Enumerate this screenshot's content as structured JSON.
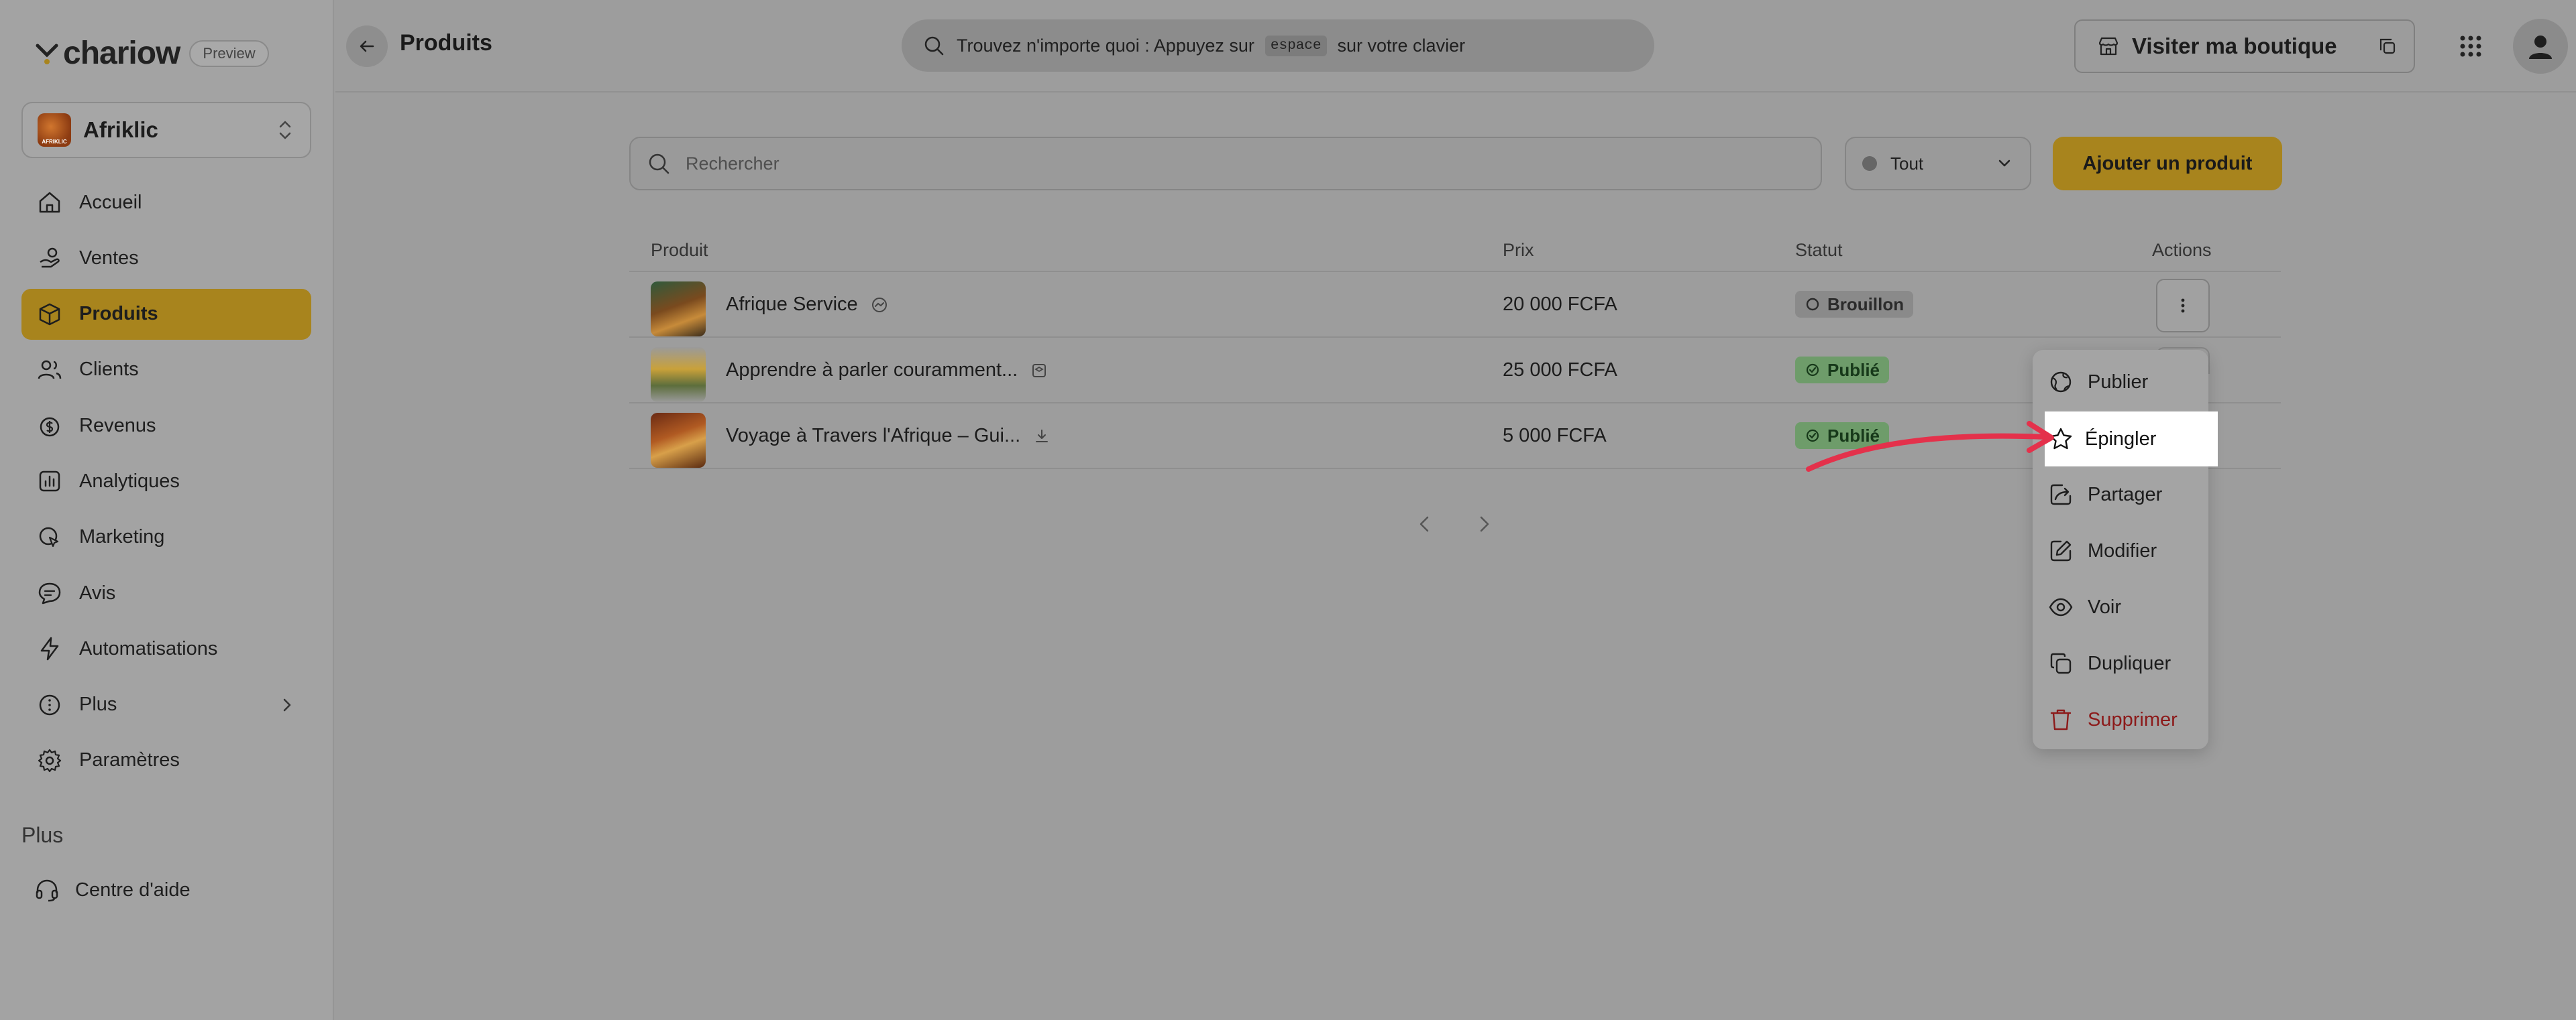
{
  "brand": {
    "name": "chariow",
    "badge": "Preview"
  },
  "workspace": {
    "name": "Afriklic",
    "avatar_text": "AFRIKLIC"
  },
  "sidebar": {
    "items": [
      {
        "label": "Accueil",
        "icon": "home-icon"
      },
      {
        "label": "Ventes",
        "icon": "sales-icon"
      },
      {
        "label": "Produits",
        "icon": "box-icon",
        "active": true
      },
      {
        "label": "Clients",
        "icon": "users-icon"
      },
      {
        "label": "Revenus",
        "icon": "revenue-icon"
      },
      {
        "label": "Analytiques",
        "icon": "analytics-icon"
      },
      {
        "label": "Marketing",
        "icon": "marketing-icon"
      },
      {
        "label": "Avis",
        "icon": "reviews-icon"
      },
      {
        "label": "Automatisations",
        "icon": "lightning-icon"
      },
      {
        "label": "Plus",
        "icon": "info-icon",
        "has_submenu": true
      },
      {
        "label": "Paramètres",
        "icon": "gear-icon"
      }
    ],
    "section_label": "Plus",
    "help_label": "Centre d'aide"
  },
  "topbar": {
    "title": "Produits",
    "search_text_before": "Trouvez n'importe quoi : Appuyez sur",
    "search_key": "espace",
    "search_text_after": "sur votre clavier",
    "visit_label": "Visiter ma boutique"
  },
  "toolbar": {
    "search_placeholder": "Rechercher",
    "filter_value": "Tout",
    "add_label": "Ajouter un produit"
  },
  "table": {
    "headers": {
      "product": "Produit",
      "price": "Prix",
      "status": "Statut",
      "actions": "Actions"
    },
    "rows": [
      {
        "name": "Afrique Service",
        "type_icon": "service-icon",
        "price": "20 000 FCFA",
        "status": "Brouillon"
      },
      {
        "name": "Apprendre à parler couramment...",
        "type_icon": "course-icon",
        "price": "25 000 FCFA",
        "status": "Publié"
      },
      {
        "name": "Voyage à Travers l'Afrique – Gui...",
        "type_icon": "download-icon",
        "price": "5 000 FCFA",
        "status": "Publié"
      }
    ]
  },
  "menu": {
    "items": [
      {
        "label": "Publier",
        "icon": "globe-icon"
      },
      {
        "label": "Épingler",
        "icon": "star-icon",
        "highlighted": true
      },
      {
        "label": "Partager",
        "icon": "share-icon"
      },
      {
        "label": "Modifier",
        "icon": "edit-icon"
      },
      {
        "label": "Voir",
        "icon": "eye-icon"
      },
      {
        "label": "Dupliquer",
        "icon": "copy-icon"
      },
      {
        "label": "Supprimer",
        "icon": "trash-icon",
        "danger": true
      }
    ]
  },
  "colors": {
    "accent": "#a8841d",
    "danger": "#8c1a1a",
    "published": "#6e9c6a",
    "annotation_arrow": "#e4314b"
  }
}
